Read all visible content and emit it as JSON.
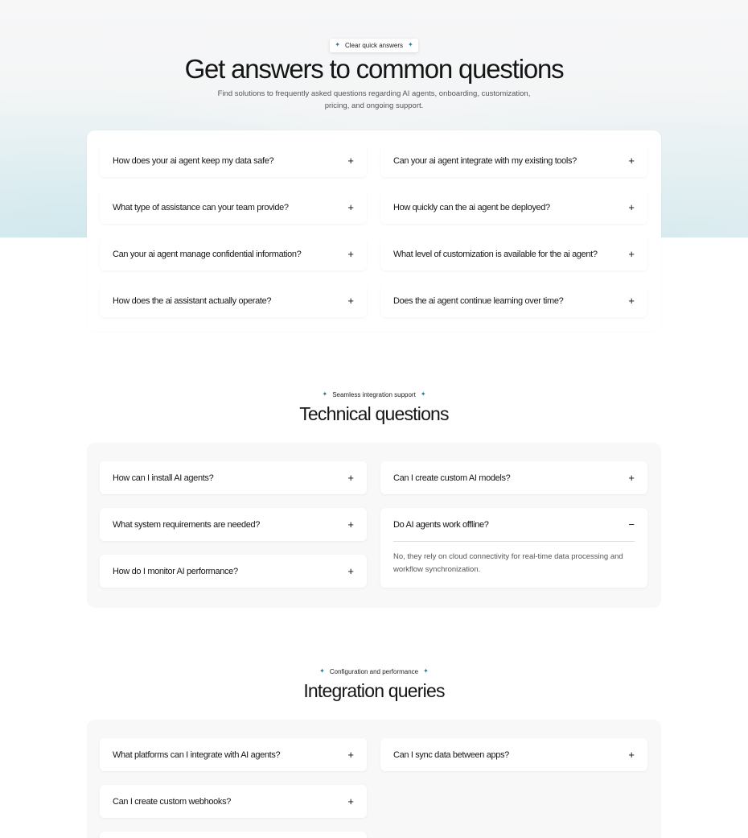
{
  "faq": {
    "badge": "Clear quick answers",
    "title": "Get answers to common questions",
    "subtitle": "Find solutions to frequently asked questions regarding AI agents, onboarding, customization, pricing, and ongoing support.",
    "left": [
      "How does your ai agent keep my data safe?",
      "What type of assistance can your team provide?",
      "Can your ai agent manage confidential information?",
      "How does the ai assistant actually operate?"
    ],
    "right": [
      "Can your ai agent integrate with my existing tools?",
      "How quickly can the ai agent be deployed?",
      "What level of customization is available for the ai agent?",
      "Does the ai agent continue learning over time?"
    ]
  },
  "technical": {
    "badge": "Seamless integration support",
    "title": "Technical questions",
    "left": [
      "How can I install AI agents?",
      "What system requirements are needed?",
      "How do I monitor AI performance?"
    ],
    "right": [
      "Can I create custom AI models?"
    ],
    "open_question": "Do AI agents work offline?",
    "open_answer": "No, they rely on cloud connectivity for real-time data processing and workflow synchronization."
  },
  "integration": {
    "badge": "Configuration and performance",
    "title": "Integration queries",
    "left": [
      "What platforms can I integrate with AI agents?",
      "Can I create custom webhooks?"
    ],
    "right": [
      "Can I sync data between apps?"
    ]
  },
  "icons": {
    "expand": "+",
    "collapse": "−",
    "sparkle": "✦"
  },
  "colors": {
    "accent": "#2c7d88",
    "panel_bg": "#f8f8f8",
    "text": "#151515"
  }
}
